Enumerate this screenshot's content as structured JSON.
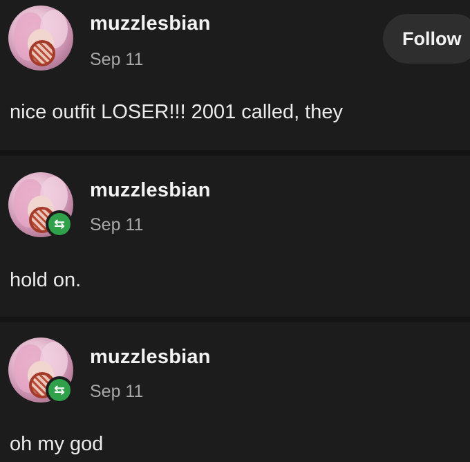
{
  "follow_label": "Follow",
  "reblog_icon": "reblog-icon",
  "accent": "#2fa14a",
  "posts": [
    {
      "username": "muzzlesbian",
      "date": "Sep 11",
      "text": "nice outfit LOSER!!! 2001 called, they"
    },
    {
      "username": "muzzlesbian",
      "date": "Sep 11",
      "text": "hold on."
    },
    {
      "username": "muzzlesbian",
      "date": "Sep 11",
      "text": "oh my god"
    }
  ]
}
